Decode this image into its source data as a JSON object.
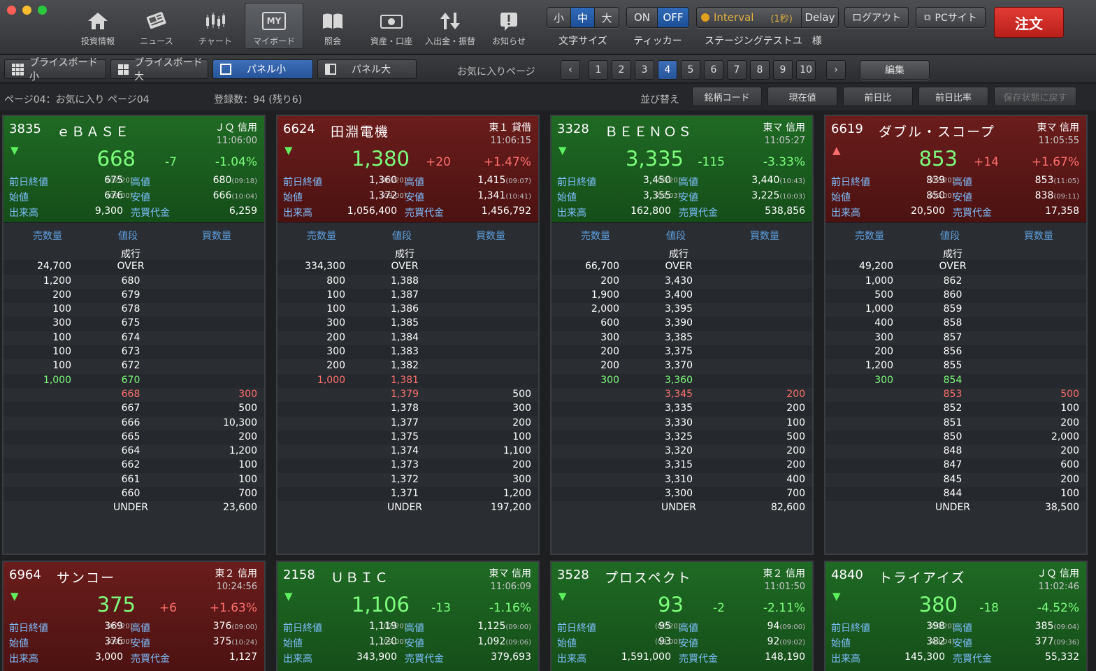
{
  "toolbar": {
    "nav": [
      {
        "label": "投資情報",
        "icon": "home-icon"
      },
      {
        "label": "ニュース",
        "icon": "newspaper-icon"
      },
      {
        "label": "チャート",
        "icon": "candlestick-chart-icon"
      },
      {
        "label": "マイボード",
        "icon": "myboard-icon",
        "active": true,
        "icon_text": "MY"
      },
      {
        "label": "照会",
        "icon": "book-icon"
      },
      {
        "label": "資産・口座",
        "icon": "cash-icon"
      },
      {
        "label": "入出金・振替",
        "icon": "transfer-arrows-icon"
      },
      {
        "label": "お知らせ",
        "icon": "notice-icon"
      }
    ],
    "font_size": {
      "caption": "文字サイズ",
      "options": [
        "小",
        "中",
        "大"
      ],
      "selected": "中"
    },
    "ticker": {
      "caption": "ティッカー",
      "on": "ON",
      "off": "OFF",
      "selected": "OFF"
    },
    "interval": {
      "label": "Interval",
      "sub": "(1秒)",
      "delay": "Delay"
    },
    "user_caption": "ステージングテストユ　様",
    "logout": "ログアウト",
    "pc_site": "PCサイト",
    "order": "注文"
  },
  "viewbar": {
    "tabs": [
      "プライスボード小",
      "プライスボード大",
      "パネル小",
      "パネル大"
    ],
    "selected_tab": "パネル小",
    "fav_label": "お気に入りページ",
    "pages": [
      "1",
      "2",
      "3",
      "4",
      "5",
      "6",
      "7",
      "8",
      "9",
      "10"
    ],
    "current_page": "4",
    "edit": "編集"
  },
  "infobar": {
    "page_label": "ページ04：お気に入り ページ04",
    "count_label": "登録数：94 (残り6)",
    "sort_label": "並び替え",
    "sort_buttons": [
      "銘柄コード",
      "現在値",
      "前日比",
      "前日比率",
      "保存状態に戻す"
    ]
  },
  "labels": {
    "prev_close": "前日終値",
    "open": "始値",
    "volume": "出来高",
    "high": "高値",
    "low": "安値",
    "turnover": "売買代金",
    "sell_qty": "売数量",
    "price": "値段",
    "buy_qty": "買数量",
    "market_order": "成行"
  },
  "panels": [
    {
      "code": "3835",
      "name": "ｅＢＡＳＥ",
      "market": "ＪＱ 信用",
      "time": "11:06:00",
      "dir": "down",
      "color": "green",
      "price": "668",
      "change": "-7",
      "pct": "-1.04%",
      "prev_close": "675",
      "prev_date": "(02/20)",
      "high": "680",
      "high_time": "(09:18)",
      "open": "676",
      "open_time": "(09:00)",
      "low": "666",
      "low_time": "(10:04)",
      "volume": "9,300",
      "turnover": "6,259",
      "book": [
        [
          "24,700",
          "OVER",
          ""
        ],
        [
          "1,200",
          "680",
          ""
        ],
        [
          "200",
          "679",
          ""
        ],
        [
          "100",
          "678",
          ""
        ],
        [
          "300",
          "675",
          ""
        ],
        [
          "100",
          "674",
          ""
        ],
        [
          "100",
          "673",
          ""
        ],
        [
          "100",
          "672",
          ""
        ],
        [
          "1,000",
          "670",
          "",
          "g"
        ],
        [
          "",
          "668",
          "300",
          "r"
        ],
        [
          "",
          "667",
          "500"
        ],
        [
          "",
          "666",
          "10,300"
        ],
        [
          "",
          "665",
          "200"
        ],
        [
          "",
          "664",
          "1,200"
        ],
        [
          "",
          "662",
          "100"
        ],
        [
          "",
          "661",
          "100"
        ],
        [
          "",
          "660",
          "700"
        ],
        [
          "",
          "UNDER",
          "23,600"
        ]
      ]
    },
    {
      "code": "6624",
      "name": "田淵電機",
      "market": "東１ 貸借",
      "time": "11:06:15",
      "dir": "down",
      "color": "red",
      "price": "1,380",
      "change": "+20",
      "pct": "+1.47%",
      "prev_close": "1,360",
      "prev_date": "(02/20)",
      "high": "1,415",
      "high_time": "(09:07)",
      "open": "1,372",
      "open_time": "(09:00)",
      "low": "1,341",
      "low_time": "(10:41)",
      "volume": "1,056,400",
      "turnover": "1,456,792",
      "book": [
        [
          "334,300",
          "OVER",
          ""
        ],
        [
          "800",
          "1,388",
          ""
        ],
        [
          "100",
          "1,387",
          ""
        ],
        [
          "100",
          "1,386",
          ""
        ],
        [
          "300",
          "1,385",
          ""
        ],
        [
          "200",
          "1,384",
          ""
        ],
        [
          "300",
          "1,383",
          ""
        ],
        [
          "200",
          "1,382",
          ""
        ],
        [
          "1,000",
          "1,381",
          "",
          "r"
        ],
        [
          "",
          "1,379",
          "500",
          "r2"
        ],
        [
          "",
          "1,378",
          "300"
        ],
        [
          "",
          "1,377",
          "200"
        ],
        [
          "",
          "1,375",
          "100"
        ],
        [
          "",
          "1,374",
          "1,100"
        ],
        [
          "",
          "1,373",
          "200"
        ],
        [
          "",
          "1,372",
          "300"
        ],
        [
          "",
          "1,371",
          "1,200"
        ],
        [
          "",
          "UNDER",
          "197,200"
        ]
      ]
    },
    {
      "code": "3328",
      "name": "ＢＥＥＮＯＳ",
      "market": "東マ 信用",
      "time": "11:05:27",
      "dir": "down",
      "color": "green",
      "price": "3,335",
      "change": "-115",
      "pct": "-3.33%",
      "prev_close": "3,450",
      "prev_date": "(02/20)",
      "high": "3,440",
      "high_time": "(10:43)",
      "open": "3,355",
      "open_time": "(09:03)",
      "low": "3,225",
      "low_time": "(10:03)",
      "volume": "162,800",
      "turnover": "538,856",
      "book": [
        [
          "66,700",
          "OVER",
          ""
        ],
        [
          "200",
          "3,430",
          ""
        ],
        [
          "1,900",
          "3,400",
          ""
        ],
        [
          "2,000",
          "3,395",
          ""
        ],
        [
          "600",
          "3,390",
          ""
        ],
        [
          "300",
          "3,385",
          ""
        ],
        [
          "200",
          "3,375",
          ""
        ],
        [
          "200",
          "3,370",
          ""
        ],
        [
          "300",
          "3,360",
          "",
          "g"
        ],
        [
          "",
          "3,345",
          "200",
          "r"
        ],
        [
          "",
          "3,335",
          "200"
        ],
        [
          "",
          "3,330",
          "100"
        ],
        [
          "",
          "3,325",
          "500"
        ],
        [
          "",
          "3,320",
          "200"
        ],
        [
          "",
          "3,315",
          "200"
        ],
        [
          "",
          "3,310",
          "400"
        ],
        [
          "",
          "3,300",
          "700"
        ],
        [
          "",
          "UNDER",
          "82,600"
        ]
      ]
    },
    {
      "code": "6619",
      "name": "ダブル・スコープ",
      "market": "東マ 信用",
      "time": "11:05:55",
      "dir": "up",
      "color": "red",
      "price": "853",
      "change": "+14",
      "pct": "+1.67%",
      "prev_close": "839",
      "prev_date": "(02/20)",
      "high": "853",
      "high_time": "(11:05)",
      "open": "850",
      "open_time": "(09:00)",
      "low": "838",
      "low_time": "(09:11)",
      "volume": "20,500",
      "turnover": "17,358",
      "book": [
        [
          "49,200",
          "OVER",
          ""
        ],
        [
          "1,000",
          "862",
          ""
        ],
        [
          "500",
          "860",
          ""
        ],
        [
          "1,000",
          "859",
          ""
        ],
        [
          "400",
          "858",
          ""
        ],
        [
          "300",
          "857",
          ""
        ],
        [
          "200",
          "856",
          ""
        ],
        [
          "1,200",
          "855",
          ""
        ],
        [
          "300",
          "854",
          "",
          "g"
        ],
        [
          "",
          "853",
          "500",
          "r"
        ],
        [
          "",
          "852",
          "100"
        ],
        [
          "",
          "851",
          "200"
        ],
        [
          "",
          "850",
          "2,000"
        ],
        [
          "",
          "848",
          "200"
        ],
        [
          "",
          "847",
          "600"
        ],
        [
          "",
          "845",
          "200"
        ],
        [
          "",
          "844",
          "100"
        ],
        [
          "",
          "UNDER",
          "38,500"
        ]
      ]
    }
  ],
  "bottom_panels": [
    {
      "code": "6964",
      "name": "サンコー",
      "market": "東２ 信用",
      "time": "10:24:56",
      "dir": "down",
      "color": "red",
      "price": "375",
      "change": "+6",
      "pct": "+1.63%",
      "prev_close": "369",
      "prev_date": "(02/20)",
      "high": "376",
      "high_time": "(09:00)",
      "open": "376",
      "open_time": "(09:00)",
      "low": "375",
      "low_time": "(10:24)",
      "volume": "3,000",
      "turnover": "1,127"
    },
    {
      "code": "2158",
      "name": "ＵＢＩＣ",
      "market": "東マ 信用",
      "time": "11:06:09",
      "dir": "down",
      "color": "green",
      "price": "1,106",
      "change": "-13",
      "pct": "-1.16%",
      "prev_close": "1,119",
      "prev_date": "(02/20)",
      "high": "1,125",
      "high_time": "(09:00)",
      "open": "1,120",
      "open_time": "(09:00)",
      "low": "1,092",
      "low_time": "(09:06)",
      "volume": "343,900",
      "turnover": "379,693"
    },
    {
      "code": "3528",
      "name": "プロスペクト",
      "market": "東２ 信用",
      "time": "11:01:50",
      "dir": "down",
      "color": "green",
      "price": "93",
      "change": "-2",
      "pct": "-2.11%",
      "prev_close": "95",
      "prev_date": "(02/20)",
      "high": "94",
      "high_time": "(09:00)",
      "open": "93",
      "open_time": "(09:00)",
      "low": "92",
      "low_time": "(09:02)",
      "volume": "1,591,000",
      "turnover": "148,190"
    },
    {
      "code": "4840",
      "name": "トライアイズ",
      "market": "ＪＱ 信用",
      "time": "11:02:46",
      "dir": "down",
      "color": "green",
      "price": "380",
      "change": "-18",
      "pct": "-4.52%",
      "prev_close": "398",
      "prev_date": "(02/20)",
      "high": "385",
      "high_time": "(09:04)",
      "open": "382",
      "open_time": "(09:04)",
      "low": "377",
      "low_time": "(09:36)",
      "volume": "145,300",
      "turnover": "55,332"
    }
  ],
  "colors": {
    "up": "#ff7070",
    "down": "#7dfc7d",
    "accent": "#2f6ab9",
    "order": "#d42a25"
  }
}
